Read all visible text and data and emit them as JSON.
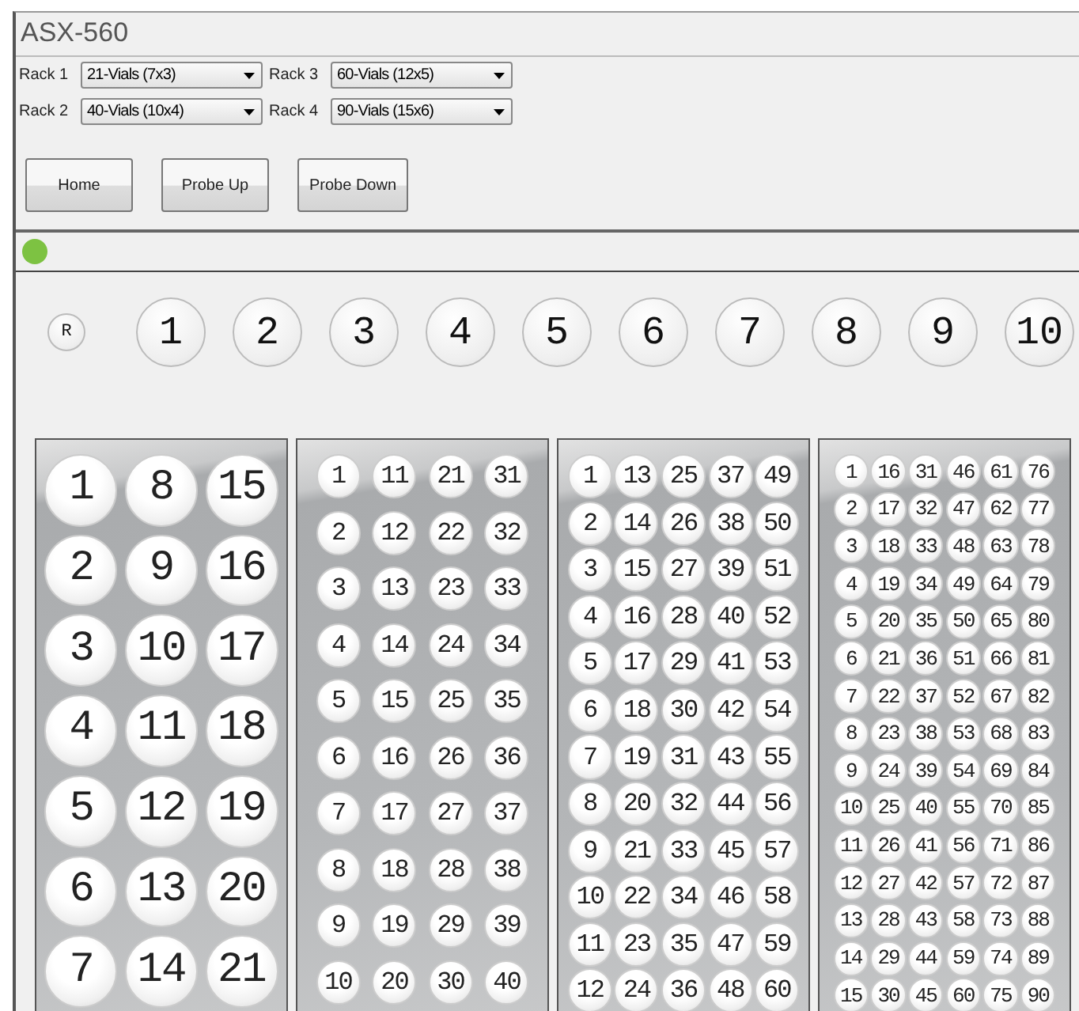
{
  "window": {
    "title": "ASX-560"
  },
  "rack_selectors": [
    {
      "label": "Rack 1",
      "value": "21-Vials (7x3)"
    },
    {
      "label": "Rack 3",
      "value": "60-Vials (12x5)"
    },
    {
      "label": "Rack 2",
      "value": "40-Vials (10x4)"
    },
    {
      "label": "Rack 4",
      "value": "90-Vials (15x6)"
    }
  ],
  "buttons": [
    "Home",
    "Probe Up",
    "Probe Down"
  ],
  "status_light": {
    "on": true
  },
  "probe_positions": [
    "R",
    "1",
    "2",
    "3",
    "4",
    "5",
    "6",
    "7",
    "8",
    "9",
    "10"
  ],
  "racks": [
    {
      "columns": [
        [
          "1",
          "2",
          "3",
          "4",
          "5",
          "6",
          "7"
        ],
        [
          "8",
          "9",
          "10",
          "11",
          "12",
          "13",
          "14"
        ],
        [
          "15",
          "16",
          "17",
          "18",
          "19",
          "20",
          "21"
        ]
      ]
    },
    {
      "columns": [
        [
          "1",
          "2",
          "3",
          "4",
          "5",
          "6",
          "7",
          "8",
          "9",
          "10"
        ],
        [
          "11",
          "12",
          "13",
          "14",
          "15",
          "16",
          "17",
          "18",
          "19",
          "20"
        ],
        [
          "21",
          "22",
          "23",
          "24",
          "25",
          "26",
          "27",
          "28",
          "29",
          "30"
        ],
        [
          "31",
          "32",
          "33",
          "34",
          "35",
          "36",
          "37",
          "38",
          "39",
          "40"
        ]
      ]
    },
    {
      "columns": [
        [
          "1",
          "2",
          "3",
          "4",
          "5",
          "6",
          "7",
          "8",
          "9",
          "10",
          "11",
          "12"
        ],
        [
          "13",
          "14",
          "15",
          "16",
          "17",
          "18",
          "19",
          "20",
          "21",
          "22",
          "23",
          "24"
        ],
        [
          "25",
          "26",
          "27",
          "28",
          "29",
          "30",
          "31",
          "32",
          "33",
          "34",
          "35",
          "36"
        ],
        [
          "37",
          "38",
          "39",
          "40",
          "41",
          "42",
          "43",
          "44",
          "45",
          "46",
          "47",
          "48"
        ],
        [
          "49",
          "50",
          "51",
          "52",
          "53",
          "54",
          "55",
          "56",
          "57",
          "58",
          "59",
          "60"
        ]
      ]
    },
    {
      "columns": [
        [
          "1",
          "2",
          "3",
          "4",
          "5",
          "6",
          "7",
          "8",
          "9",
          "10",
          "11",
          "12",
          "13",
          "14",
          "15"
        ],
        [
          "16",
          "17",
          "18",
          "19",
          "20",
          "21",
          "22",
          "23",
          "24",
          "25",
          "26",
          "27",
          "28",
          "29",
          "30"
        ],
        [
          "31",
          "32",
          "33",
          "34",
          "35",
          "36",
          "37",
          "38",
          "39",
          "40",
          "41",
          "42",
          "43",
          "44",
          "45"
        ],
        [
          "46",
          "47",
          "48",
          "49",
          "50",
          "51",
          "52",
          "53",
          "54",
          "55",
          "56",
          "57",
          "58",
          "59",
          "60"
        ],
        [
          "61",
          "62",
          "63",
          "64",
          "65",
          "66",
          "67",
          "68",
          "69",
          "70",
          "71",
          "72",
          "73",
          "74",
          "75"
        ],
        [
          "76",
          "77",
          "78",
          "79",
          "80",
          "81",
          "82",
          "83",
          "84",
          "85",
          "86",
          "87",
          "88",
          "89",
          "90"
        ]
      ]
    }
  ]
}
